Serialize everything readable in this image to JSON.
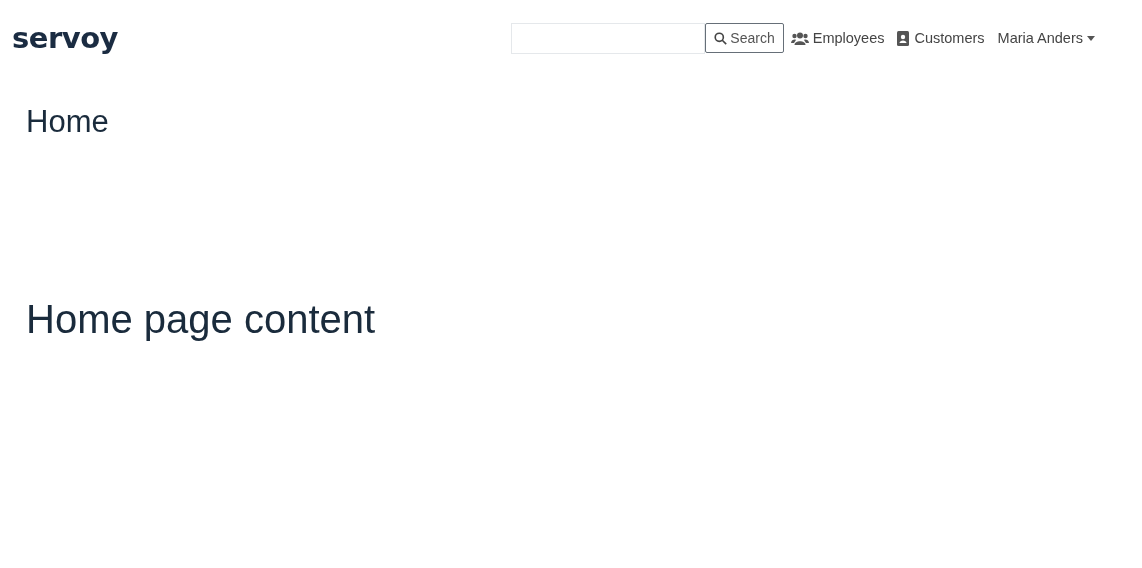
{
  "navbar": {
    "logo": "servoy",
    "search": {
      "button": "Search"
    },
    "links": [
      {
        "kind": "employees",
        "label": "Employees"
      },
      {
        "kind": "customers",
        "label": "Customers"
      }
    ],
    "user_menu": "Maria Anders"
  },
  "page": {
    "title": "Home",
    "content": "Home page content"
  }
}
